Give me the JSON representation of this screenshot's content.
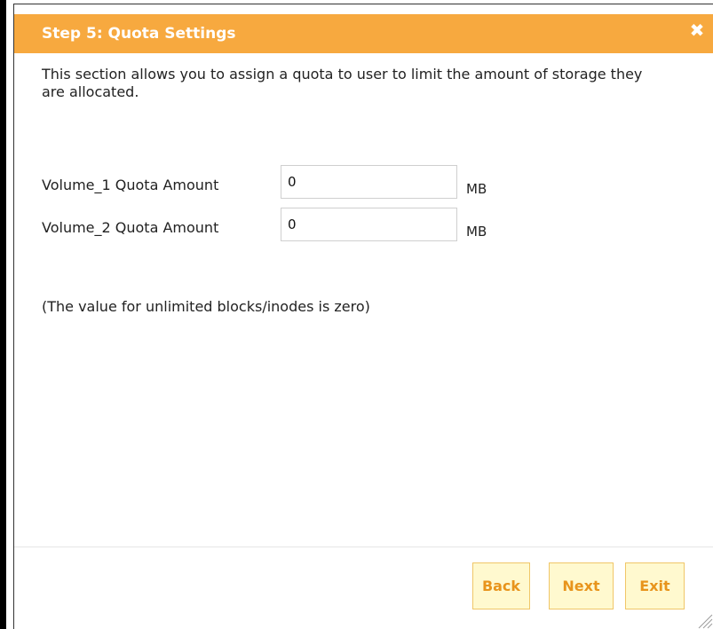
{
  "dialog": {
    "title": "Step 5: Quota Settings",
    "close_icon": "close-icon",
    "description": "This section allows you to assign a quota to user to limit the amount of storage they are allocated.",
    "quotas": [
      {
        "label": "Volume_1 Quota Amount",
        "value": "0",
        "unit": "MB"
      },
      {
        "label": "Volume_2 Quota Amount",
        "value": "0",
        "unit": "MB"
      }
    ],
    "note": "(The value for unlimited blocks/inodes is zero)",
    "buttons": {
      "back": "Back",
      "next": "Next",
      "exit": "Exit"
    },
    "resize_icon": "resize-grip-icon"
  },
  "colors": {
    "titlebar": "#f7a93f",
    "button_bg": "#fff9cf",
    "button_text": "#e8941c",
    "button_border": "#f0c668"
  }
}
